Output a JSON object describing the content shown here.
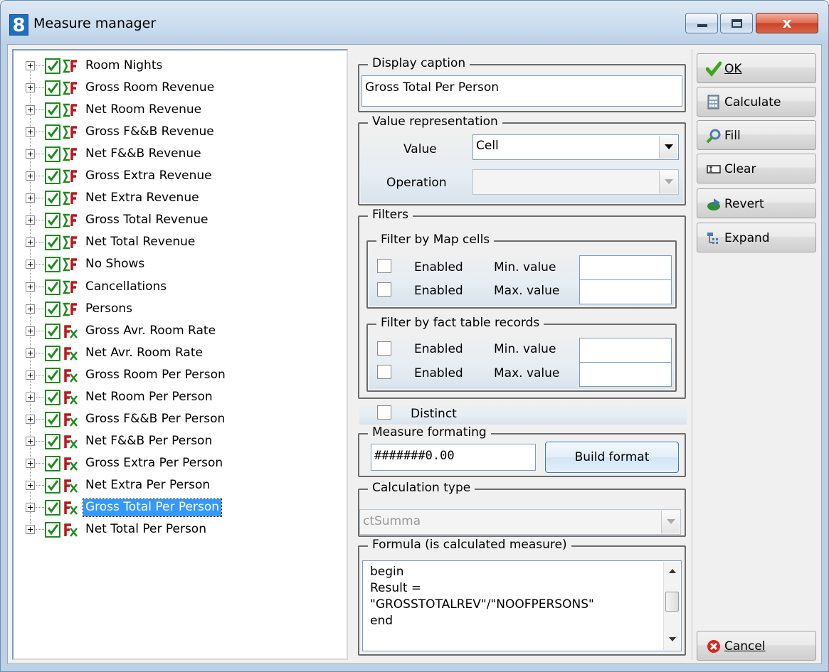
{
  "window": {
    "title": "Measure manager",
    "app_icon": "8",
    "close_glyph": "x"
  },
  "tree": {
    "selected_index": 20,
    "items": [
      {
        "label": "Room Nights",
        "icon": "sigma-icon"
      },
      {
        "label": "Gross Room Revenue",
        "icon": "sigma-icon"
      },
      {
        "label": "Net Room Revenue",
        "icon": "sigma-icon"
      },
      {
        "label": "Gross F&&B Revenue",
        "icon": "sigma-icon"
      },
      {
        "label": "Net F&&B Revenue",
        "icon": "sigma-icon"
      },
      {
        "label": "Gross Extra Revenue",
        "icon": "sigma-icon"
      },
      {
        "label": "Net Extra Revenue",
        "icon": "sigma-icon"
      },
      {
        "label": "Gross Total Revenue",
        "icon": "sigma-icon"
      },
      {
        "label": "Net Total Revenue",
        "icon": "sigma-icon"
      },
      {
        "label": "No Shows",
        "icon": "sigma-icon"
      },
      {
        "label": "Cancellations",
        "icon": "sigma-icon"
      },
      {
        "label": "Persons",
        "icon": "sigma-icon"
      },
      {
        "label": "Gross Avr. Room Rate",
        "icon": "fx-icon"
      },
      {
        "label": "Net Avr. Room Rate",
        "icon": "fx-icon"
      },
      {
        "label": "Gross Room Per Person",
        "icon": "fx-icon"
      },
      {
        "label": "Net Room Per Person",
        "icon": "fx-icon"
      },
      {
        "label": "Gross F&&B Per Person",
        "icon": "fx-icon"
      },
      {
        "label": "Net F&&B Per Person",
        "icon": "fx-icon"
      },
      {
        "label": "Gross Extra Per Person",
        "icon": "fx-icon"
      },
      {
        "label": "Net Extra Per Person",
        "icon": "fx-icon"
      },
      {
        "label": "Gross Total Per Person",
        "icon": "fx-icon"
      },
      {
        "label": "Net Total Per Person",
        "icon": "fx-icon"
      }
    ]
  },
  "display_caption": {
    "title": "Display caption",
    "value": "Gross Total Per Person"
  },
  "value_representation": {
    "title": "Value representation",
    "value_label": "Value",
    "value": "Cell",
    "operation_label": "Operation",
    "operation": ""
  },
  "filters": {
    "title": "Filters",
    "map_cells": {
      "title": "Filter by Map cells",
      "rows": [
        {
          "enabled_label": "Enabled",
          "bound_label": "Min. value",
          "value": "",
          "checked": false
        },
        {
          "enabled_label": "Enabled",
          "bound_label": "Max. value",
          "value": "",
          "checked": false
        }
      ]
    },
    "fact_table": {
      "title": "Filter by fact table records",
      "rows": [
        {
          "enabled_label": "Enabled",
          "bound_label": "Min. value",
          "value": "",
          "checked": false
        },
        {
          "enabled_label": "Enabled",
          "bound_label": "Max. value",
          "value": "",
          "checked": false
        }
      ]
    }
  },
  "distinct": {
    "label": "Distinct",
    "checked": false
  },
  "measure_formatting": {
    "title": "Measure formating",
    "value": "#######0.00",
    "button": "Build format"
  },
  "calculation_type": {
    "title": "Calculation type",
    "value": "ctSumma"
  },
  "formula": {
    "title": "Formula (is calculated measure)",
    "text": "begin\nResult =\n\"GROSSTOTALREV\"/\"NOOFPERSONS\"\nend"
  },
  "buttons": {
    "ok": "OK",
    "calculate": "Calculate",
    "fill": "Fill",
    "clear": "Clear",
    "revert": "Revert",
    "expand": "Expand",
    "cancel": "Cancel"
  },
  "colors": {
    "selection": "#3399ff",
    "check_green": "#1e8c1e",
    "sigma_red": "#c0141b"
  }
}
